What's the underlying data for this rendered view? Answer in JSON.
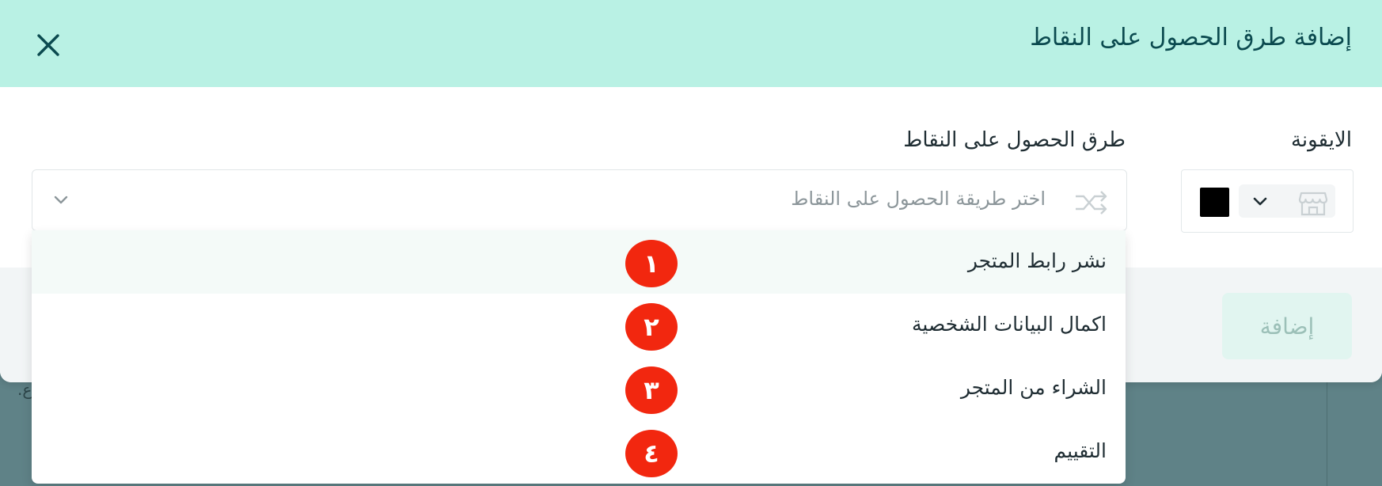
{
  "modal": {
    "title": "إضافة طرق الحصول على النقاط",
    "close_icon": "close-icon"
  },
  "form": {
    "icon_label": "الايقونة",
    "icon_picker": {
      "store_icon": "store-icon",
      "chevron_icon": "chevron-down-icon",
      "color": "#000000"
    },
    "methods_label": "طرق الحصول على النقاط",
    "select": {
      "placeholder": "اختر طريقة الحصول على النقاط",
      "leading_icon": "shuffle-icon",
      "chevron_icon": "chevron-down-icon"
    }
  },
  "dropdown": {
    "options": [
      {
        "label": "نشر رابط المتجر",
        "badge": "١"
      },
      {
        "label": "اكمال البيانات الشخصية",
        "badge": "٢"
      },
      {
        "label": "الشراء من المتجر",
        "badge": "٣"
      },
      {
        "label": "التقييم",
        "badge": "٤"
      }
    ]
  },
  "footer": {
    "add_label": "إضافة"
  },
  "backdrop": {
    "fragment": ".ع"
  },
  "colors": {
    "header_bg": "#b9f1e4",
    "title": "#0b4a4f",
    "badge": "#f2270f",
    "add_button_bg": "#e1f5f0"
  }
}
